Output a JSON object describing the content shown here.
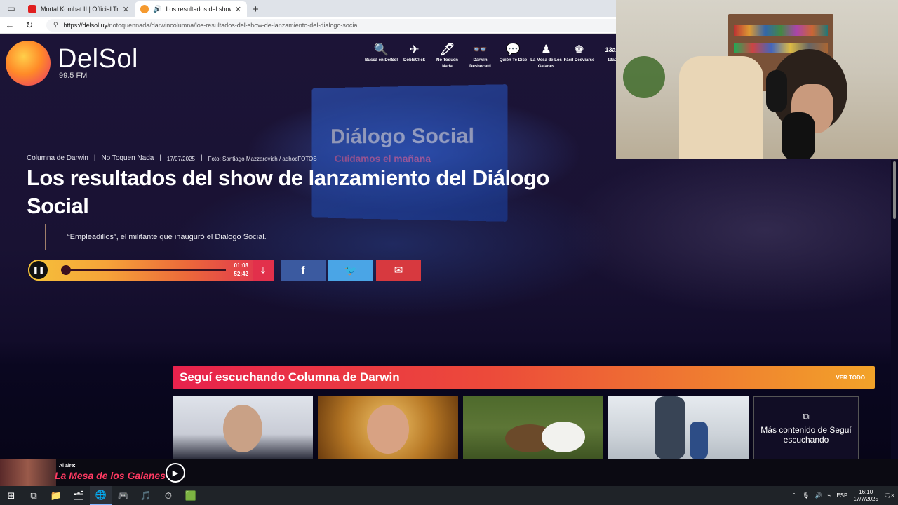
{
  "browser": {
    "tabs": [
      {
        "title": "Mortal Kombat II | Official Trailer",
        "favicon_color": "#e01f1f",
        "active": false
      },
      {
        "title": "Los resultados del show de l...",
        "favicon_color": "#f59a2f",
        "active": true
      }
    ],
    "url_host": "https://delsol.uy",
    "url_path": "/notoquennada/darwincolumna/los-resultados-del-show-de-lanzamiento-del-dialogo-social"
  },
  "site": {
    "logo_name": "DelSol",
    "logo_freq": "99.5 FM",
    "nav": [
      {
        "icon": "🔍",
        "label": "Buscá en DelSol",
        "name": "nav-search"
      },
      {
        "icon": "✈",
        "label": "DobleClick",
        "name": "nav-dobleclick"
      },
      {
        "icon": "🖊",
        "label": "No Toquen Nada",
        "name": "nav-no-toquen-nada"
      },
      {
        "icon": "👓",
        "label": "Darwin Desbocatti",
        "name": "nav-darwin-desbocatti"
      },
      {
        "icon": "💬",
        "label": "Quién Te Dice",
        "name": "nav-quien-te-dice"
      },
      {
        "icon": "♟",
        "label": "La Mesa de Los Galanes",
        "name": "nav-la-mesa"
      },
      {
        "icon": "♚",
        "label": "Fácil Desviarse",
        "name": "nav-facil-desviarse"
      },
      {
        "icon": "13a0",
        "label": "13a0",
        "name": "nav-13a0"
      }
    ]
  },
  "hero": {
    "screen_text_1": "Diálogo Social",
    "screen_text_2": "Cuidamos el mañana",
    "meta": {
      "section": "Columna de Darwin",
      "program": "No Toquen Nada",
      "date": "17/07/2025",
      "photo": "Foto: Santiago Mazzarovich / adhocFOTOS",
      "sep": "|"
    },
    "title": "Los resultados del show de lanzamiento del Diálogo Social",
    "quote": "“Empleadillos”, el militante que inauguró el Diálogo Social."
  },
  "player": {
    "play_icon": "❚❚",
    "elapsed": "01:03",
    "duration": "52:42",
    "progress_fraction": 0.02,
    "download_icon": "⤓",
    "share": {
      "facebook": "f",
      "twitter": "🐦",
      "mail": "✉"
    }
  },
  "related": {
    "heading": "Seguí escuchando Columna de Darwin",
    "see_all": "VER TODO",
    "more_icon": "⧉",
    "more_text": "Más contenido de Seguí escuchando"
  },
  "now_playing": {
    "label": "Al aire:",
    "title": "La Mesa de los Galanes",
    "play_icon": "▶"
  },
  "taskbar": {
    "icons": [
      "⊞",
      "⧉",
      "📁",
      "🗂",
      "🌐",
      "🎮",
      "🎵",
      "⏱",
      "🟩"
    ],
    "lang": "ESP",
    "time": "16:10",
    "date": "17/7/2025",
    "notif": "3"
  },
  "colors": {
    "accent_red": "#e8224d",
    "accent_orange": "#f2a329",
    "bg_dark": "#0b0820"
  }
}
